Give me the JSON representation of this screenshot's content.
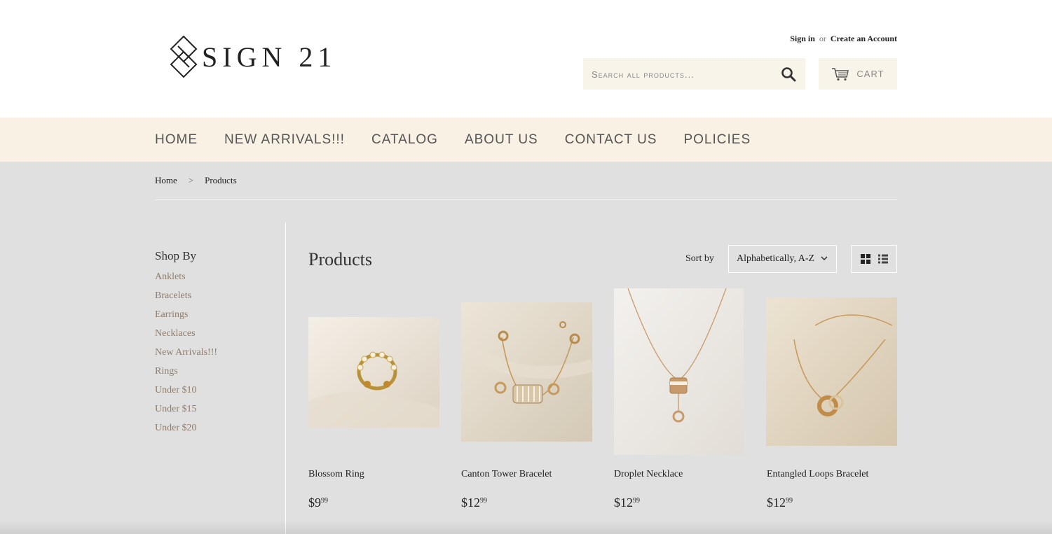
{
  "brand": {
    "logo_text": "SIGN 21"
  },
  "account": {
    "sign_in": "Sign in",
    "or": "or",
    "create": "Create an Account"
  },
  "search": {
    "placeholder": "Search all products..."
  },
  "cart": {
    "label": "CART"
  },
  "nav": [
    "HOME",
    "NEW ARRIVALS!!!",
    "CATALOG",
    "ABOUT US",
    "CONTACT US",
    "POLICIES"
  ],
  "breadcrumb": {
    "home": "Home",
    "separator": ">",
    "current": "Products"
  },
  "sidebar": {
    "title": "Shop By",
    "items": [
      "Anklets",
      "Bracelets",
      "Earrings",
      "Necklaces",
      "New Arrivals!!!",
      "Rings",
      "Under $10",
      "Under $15",
      "Under $20"
    ]
  },
  "main": {
    "title": "Products",
    "sort_label": "Sort by",
    "sort_value": "Alphabetically, A-Z"
  },
  "products": [
    {
      "name": "Blossom Ring",
      "price_main": "$9",
      "price_cents": "99"
    },
    {
      "name": "Canton Tower Bracelet",
      "price_main": "$12",
      "price_cents": "99"
    },
    {
      "name": "Droplet Necklace",
      "price_main": "$12",
      "price_cents": "99"
    },
    {
      "name": "Entangled Loops Bracelet",
      "price_main": "$12",
      "price_cents": "99"
    }
  ],
  "colors": {
    "header_bg": "#ffffff",
    "nav_bg": "#f9f1e3",
    "page_bg": "#e0e0e0",
    "link_color": "#8f7c6b"
  }
}
